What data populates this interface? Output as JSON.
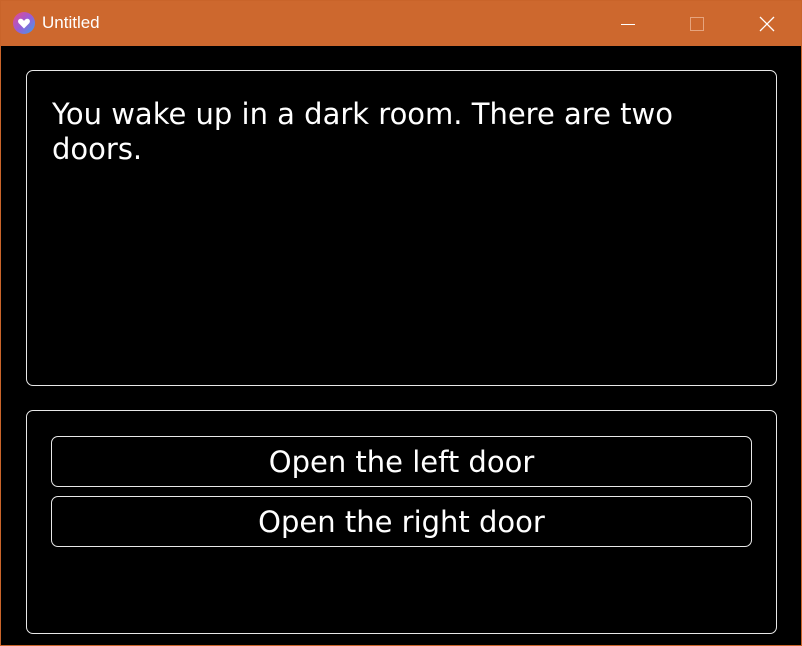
{
  "window": {
    "title": "Untitled",
    "titlebar_color": "#cd682e",
    "icons": {
      "app": "heart-app-icon",
      "minimize": "minimize-icon",
      "maximize": "maximize-icon",
      "close": "close-icon"
    }
  },
  "story": {
    "text": "You wake up in a dark room. There are two doors."
  },
  "choices": [
    {
      "label": "Open the left door"
    },
    {
      "label": "Open the right door"
    }
  ]
}
